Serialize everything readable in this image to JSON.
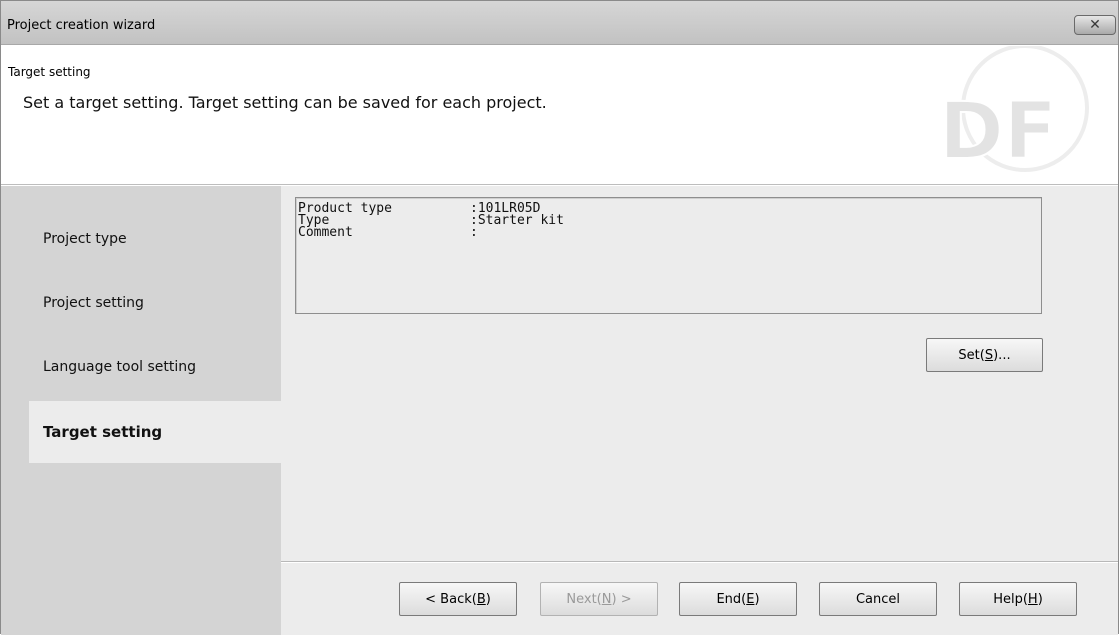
{
  "window": {
    "title": "Project creation wizard",
    "close_label": "✕"
  },
  "header": {
    "title": "Target setting",
    "description": "Set a target setting. Target setting can be saved for each project.",
    "logo_text": "DF"
  },
  "sidebar": {
    "items": [
      {
        "label": "Project type",
        "active": false
      },
      {
        "label": "Project setting",
        "active": false
      },
      {
        "label": "Language tool setting",
        "active": false
      },
      {
        "label": "Target setting",
        "active": true
      }
    ]
  },
  "info": {
    "rows": [
      {
        "key": "Product type",
        "value": ":101LR05D"
      },
      {
        "key": "Type",
        "value": ":Starter kit"
      },
      {
        "key": "Comment",
        "value": ":"
      }
    ]
  },
  "buttons": {
    "set": {
      "text": "Set(",
      "key": "S",
      "suffix": ")..."
    },
    "back": {
      "text": "< Back(",
      "key": "B",
      "suffix": ")"
    },
    "next": {
      "text": "Next(",
      "key": "N",
      "suffix": ") >"
    },
    "end": {
      "text": "End(",
      "key": "E",
      "suffix": ")"
    },
    "cancel": {
      "text": "Cancel"
    },
    "help": {
      "text": "Help(",
      "key": "H",
      "suffix": ")"
    }
  },
  "colors": {
    "sidebar": "#d4d4d4",
    "panel": "#ececec",
    "title_bar": "#c8c8c8"
  }
}
